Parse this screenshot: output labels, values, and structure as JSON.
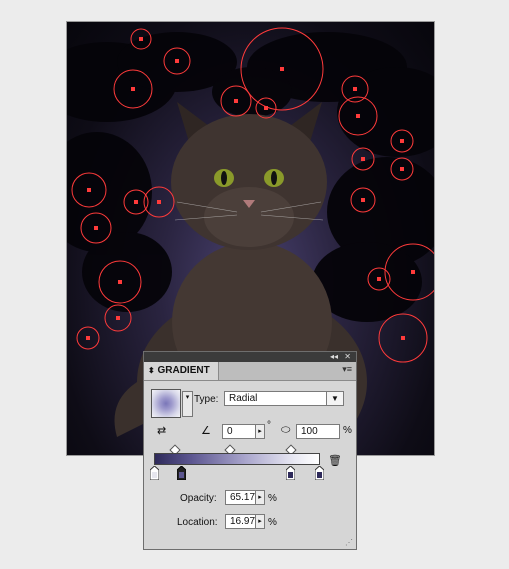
{
  "panel": {
    "title": "GRADIENT",
    "collapse_icon": "double-arrow-icon",
    "close_icon": "close-icon",
    "menu_icon": "panel-menu-icon",
    "type_label": "Type:",
    "type_value": "Radial",
    "angle_value": "0",
    "degree_symbol": "°",
    "aspect_value": "100",
    "percent": "%",
    "opacity_label": "Opacity:",
    "opacity_value": "65.17",
    "location_label": "Location:",
    "location_value": "16.97",
    "delete_icon": "trash-icon",
    "reverse_icon": "reverse-gradient-icon",
    "angle_icon": "angle-icon",
    "aspect_icon": "aspect-ratio-icon"
  },
  "colors": {
    "panel_bg": "#d6d6d6",
    "guide_red": "#ff3b3b",
    "gradient_start": "#2e2a5a",
    "gradient_end": "#ffffff"
  }
}
